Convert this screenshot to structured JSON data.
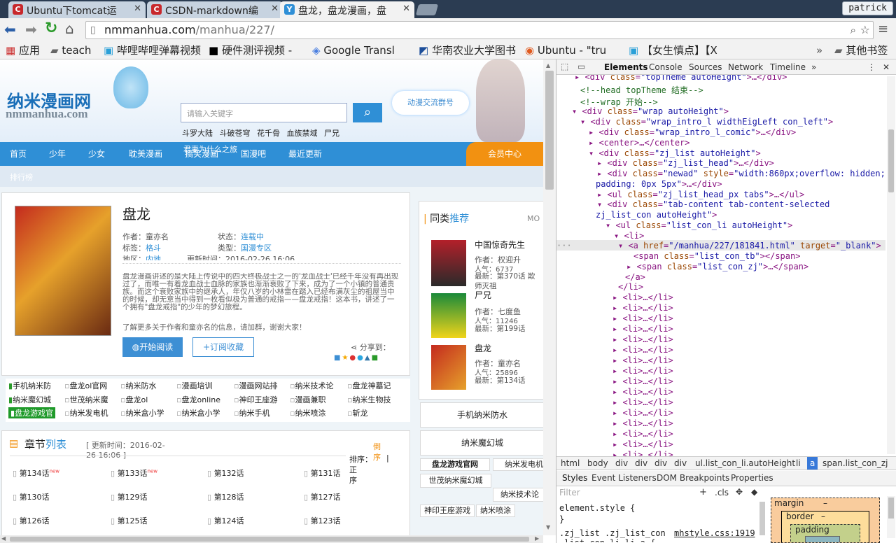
{
  "browser": {
    "tabs": [
      {
        "label": "Ubuntu下tomcat运",
        "icon": "csdn-icon"
      },
      {
        "label": "CSDN-markdown编",
        "icon": "csdn-icon"
      },
      {
        "label": "盘龙，盘龙漫画，盘",
        "icon": "nmmanhua-icon"
      }
    ],
    "user": "patrick",
    "url_host": "nmmanhua.com",
    "url_path": "/manhua/227/",
    "bookmarks": [
      "应用",
      "teach",
      "哔哩哔哩弹幕视频",
      "硬件测评视频 -",
      "Google Transl",
      "华南农业大学图书",
      "Ubuntu - \"tru",
      "【女生慎点】【X"
    ],
    "other_bookmarks": "其他书签"
  },
  "site": {
    "logo_cn": "纳米漫画网",
    "logo_en": "nmmanhua.com",
    "search_placeholder": "请输入关键字",
    "hot_words": [
      "斗罗大陆",
      "斗破苍穹",
      "花千骨",
      "血族禁域",
      "尸兄",
      "君妻为什么之旅"
    ],
    "qq_group": "动漫交流群号",
    "nav": [
      "首页",
      "少年",
      "少女",
      "耽美漫画",
      "搞笑漫画",
      "国漫吧",
      "最近更新"
    ],
    "member_center": "会员中心",
    "rank": "排行榜"
  },
  "comic": {
    "title": "盘龙",
    "author_label": "作者：",
    "author": "童亦名",
    "status_label": "状态：",
    "status": "连载中",
    "tag_label": "标签：",
    "tag": "格斗",
    "type_label": "类型：",
    "type": "国漫专区",
    "region_label": "地区：",
    "region": "内地",
    "updated": "更新时间：2016-02-26 16:06",
    "desc": "盘龙漫画讲述的是大陆上传说中的四大终极战士之一的'龙血战士'已经千年没有再出现过了，而唯一有着龙血战士血脉的家族也渐渐衰败了下来，成为了一个小镇的普通贵族。而这个衰败家族中的继承人，年仅八岁的小林雷在踏入已经布满灰尘的祖屋当中的时候，却无意当中得到一枚看似极为普通的戒指——盘龙戒指！这本书，讲述了一个拥有\"盘龙戒指\"的少年的梦幻旅程。",
    "desc_more": "了解更多关于作者和童亦名的信息，请加群，谢谢大家！",
    "read_btn": "开始阅读",
    "fav_btn": "+订阅收藏",
    "share": "分享到："
  },
  "links": [
    [
      "手机纳米防",
      "盘龙ol官网",
      "纳米防水",
      "漫画培训",
      "漫画网站排",
      "纳米技术论",
      "盘龙神墓记"
    ],
    [
      "纳米魔幻城",
      "世茂纳米魔",
      "盘龙ol",
      "盘龙online",
      "神印王座游",
      "漫画兼职",
      "纳米生物技"
    ],
    [
      "盘龙游戏官",
      "纳米发电机",
      "纳米盒小学",
      "纳米盒小学",
      "纳米手机",
      "纳米喷涂",
      "斩龙"
    ]
  ],
  "chapters": {
    "title_a": "章节",
    "title_b": "列表",
    "updated": "[ 更新时间：2016-02-26 16:06 ]",
    "sort": "排序：",
    "sort_desc": "倒序",
    "sort_sep": "|",
    "sort_asc": "正序",
    "new_badge": "new",
    "rows": [
      [
        "第134话",
        "第133话",
        "第132话",
        "第131话"
      ],
      [
        "第130话",
        "第129话",
        "第128话",
        "第127话"
      ],
      [
        "第126话",
        "第125话",
        "第124话",
        "第123话"
      ]
    ]
  },
  "related": {
    "title_a": "同类",
    "title_b": "推荐",
    "more": "MO",
    "items": [
      {
        "name": "中国惊奇先生",
        "author": "作者：权迎升",
        "pop": "人气：6737",
        "latest": "最新：第370话 欺师灭祖"
      },
      {
        "name": "尸兄",
        "author": "作者：七度鱼",
        "pop": "人气：11246",
        "latest": "最新：第199话"
      },
      {
        "name": "盘龙",
        "author": "作者：童亦名",
        "pop": "人气：25896",
        "latest": "最新：第134话"
      }
    ],
    "ads": [
      "手机纳米防水",
      "纳米魔幻城"
    ],
    "ad_links": [
      "盘龙游戏官网",
      "纳米发电机",
      "世茂纳米魔幻城",
      "纳米技术论",
      "神印王座游戏",
      "纳米喷涂"
    ]
  },
  "devtools": {
    "tabs": [
      "Elements",
      "Console",
      "Sources",
      "Network",
      "Timeline"
    ],
    "breadcrumb": [
      "html",
      "body",
      "div",
      "div",
      "div",
      "div",
      "ul.list_con_li.autoHeight",
      "li",
      "a",
      "span.list_con_zj"
    ],
    "styles_tabs": [
      "Styles",
      "Event Listeners",
      "DOM Breakpoints",
      "Properties"
    ],
    "filter": "Filter",
    "cls": ".cls",
    "rule1": "element.style {",
    "rule1_end": "}",
    "rule2": ".zj_list .zj_list_con",
    "rule2_src": "mhstyle.css:1919",
    "rule2b": ".list_con_li li a {",
    "box": [
      "margin",
      "border",
      "padding"
    ],
    "dash": "–"
  }
}
